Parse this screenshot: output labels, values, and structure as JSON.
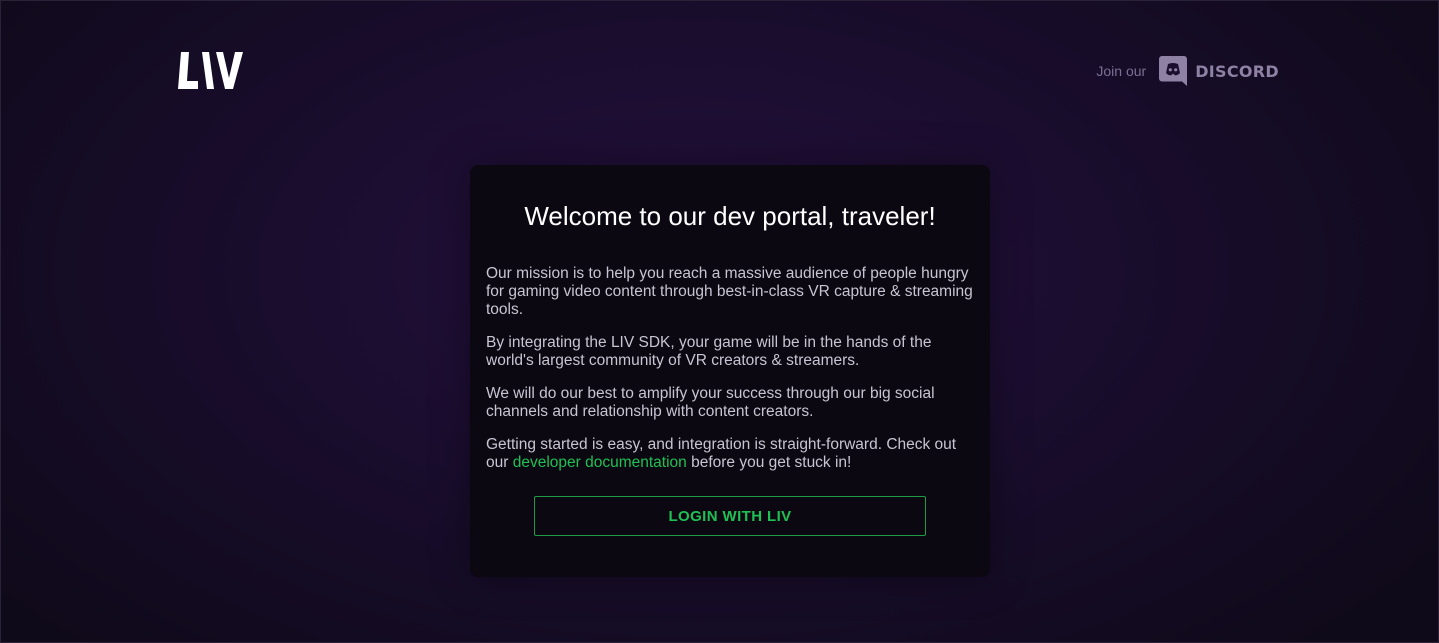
{
  "header": {
    "logo_text": "LIV",
    "discord": {
      "join_label": "Join our",
      "brand_label": "DISCORD",
      "icon": "discord-icon"
    }
  },
  "card": {
    "title": "Welcome to our dev portal, traveler!",
    "paragraphs": [
      "Our mission is to help you reach a massive audience of people hungry for gaming video content through best-in-class VR capture & streaming tools.",
      "By integrating the LIV SDK, your game will be in the hands of the world's largest community of VR creators & streamers.",
      "We will do our best to amplify your success through our big social channels and relationship with content creators."
    ],
    "getting_started": {
      "before_link": "Getting started is easy, and integration is straight-forward. Check out our ",
      "link_label": "developer documentation",
      "after_link": " before you get stuck in!"
    },
    "login_button_label": "LOGIN WITH LIV"
  },
  "colors": {
    "accent_green": "#1fc054",
    "background": "#1a0d2e",
    "card_background": "#0b0812",
    "muted_text": "#7d6f92"
  }
}
